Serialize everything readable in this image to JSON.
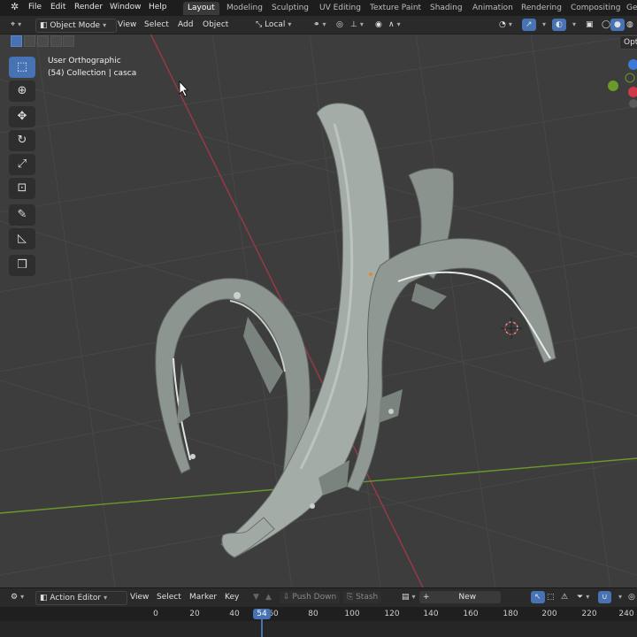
{
  "menubar": {
    "items": [
      "File",
      "Edit",
      "Render",
      "Window",
      "Help"
    ],
    "workspace_tabs": [
      "Layout",
      "Modeling",
      "Sculpting",
      "UV Editing",
      "Texture Paint",
      "Shading",
      "Animation",
      "Rendering",
      "Compositing",
      "Ge"
    ],
    "active_tab": "Layout"
  },
  "header": {
    "mode": "Object Mode",
    "menus": [
      "View",
      "Select",
      "Add",
      "Object"
    ],
    "transform_orientation": "Local",
    "options_label": "Opt"
  },
  "viewport": {
    "view_name": "User Orthographic",
    "collection_info": "(54) Collection | casca"
  },
  "toolbar": {
    "tools": [
      "select-box",
      "cursor",
      "move",
      "rotate",
      "scale",
      "transform",
      "annotate",
      "measure",
      "add-cube"
    ],
    "active_tool": "select-box"
  },
  "action_editor": {
    "editor_type": "Action Editor",
    "menus": [
      "View",
      "Select",
      "Marker",
      "Key"
    ],
    "push_down_label": "Push Down",
    "stash_label": "Stash",
    "new_label": "New"
  },
  "timeline": {
    "ticks": [
      "0",
      "20",
      "40",
      "60",
      "80",
      "100",
      "120",
      "140",
      "160",
      "180",
      "200",
      "220",
      "240"
    ],
    "current_frame": "54"
  },
  "colors": {
    "accent": "#4772b3",
    "x_axis": "#b4404a",
    "y_axis": "#6a9a2a",
    "background": "#3d3d3d"
  }
}
